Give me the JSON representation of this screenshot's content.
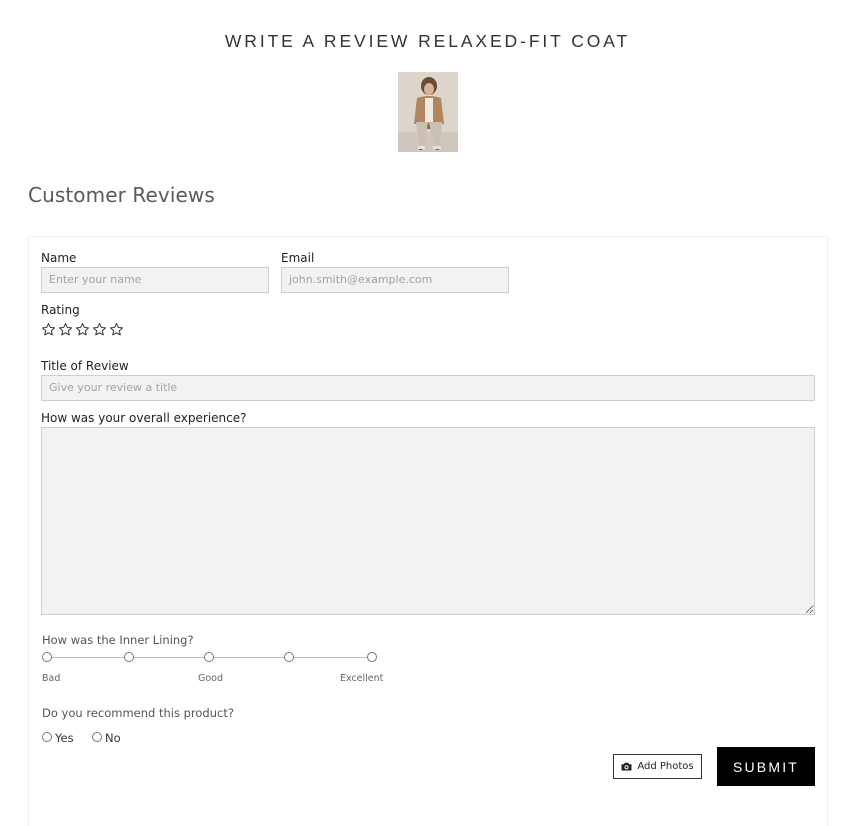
{
  "page": {
    "title": "WRITE A REVIEW RELAXED-FIT COAT",
    "section_title": "Customer Reviews"
  },
  "product_image": {
    "alt": "product photo",
    "icon": "product-photo"
  },
  "form": {
    "name": {
      "label": "Name",
      "placeholder": "Enter your name"
    },
    "email": {
      "label": "Email",
      "placeholder": "john.smith@example.com"
    },
    "rating": {
      "label": "Rating",
      "max": 5,
      "value": 0,
      "icon": "star-outline-icon"
    },
    "title": {
      "label": "Title of Review",
      "placeholder": "Give your review a title"
    },
    "experience": {
      "label": "How was your overall experience?",
      "value": ""
    },
    "inner_lining": {
      "question": "How was the Inner Lining?",
      "points": 5,
      "labels": {
        "low": "Bad",
        "mid": "Good",
        "high": "Excellent"
      }
    },
    "recommend": {
      "question": "Do you recommend this product?",
      "options": [
        "Yes",
        "No"
      ]
    },
    "add_photos_label": "Add Photos",
    "submit_label": "SUBMIT"
  },
  "colors": {
    "field_bg": "#f2f2f2",
    "field_border": "#cfcfcf",
    "submit_bg": "#000000",
    "submit_text": "#ffffff"
  }
}
